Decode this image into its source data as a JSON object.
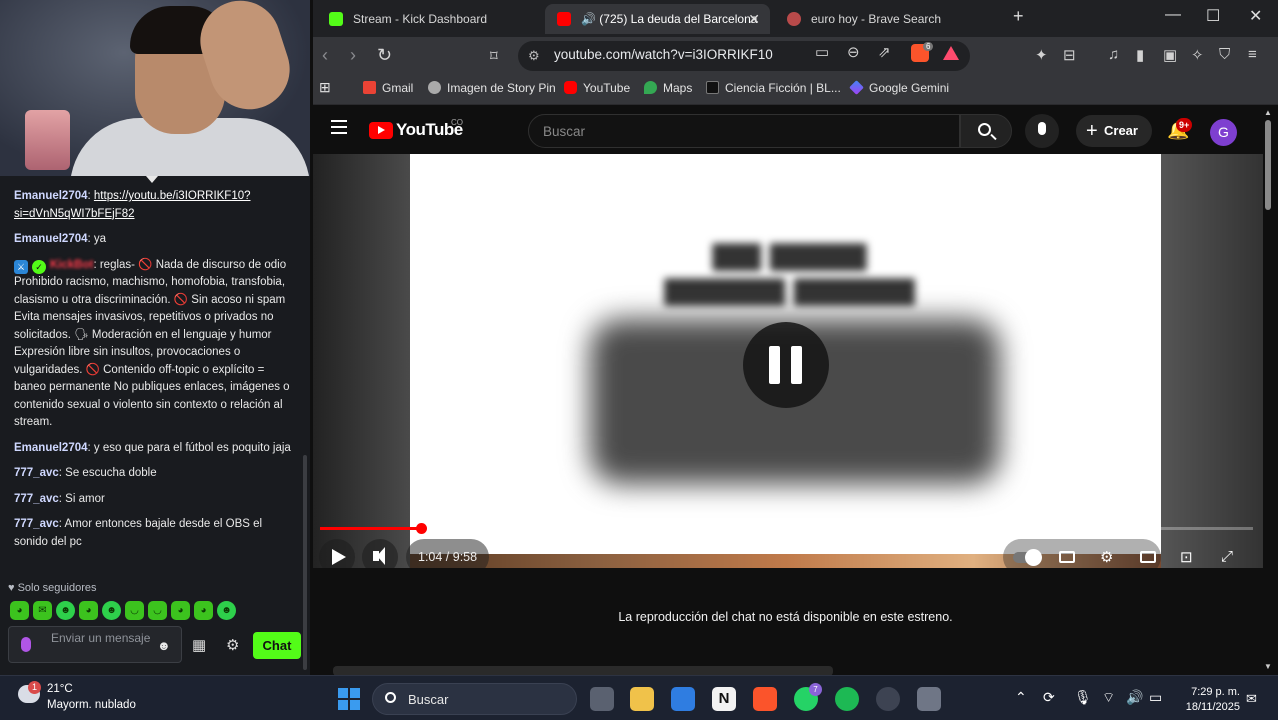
{
  "chat": {
    "messages": [
      {
        "user": "Emanuel2704",
        "sep": ": ",
        "link": "https://youtu.be/i3IORRIKF10?si=dVnN5qWI7bFEjF82"
      },
      {
        "user": "Emanuel2704",
        "sep": ": ",
        "text": "ya"
      },
      {
        "user": "KickBot",
        "sep": ": ",
        "text": "reglas- 🚫 Nada de discurso de odio Prohibido racismo, machismo, homofobia, transfobia, clasismo u otra discriminación. 🚫 Sin acoso ni spam Evita mensajes invasivos, repetitivos o privados no solicitados. 🗣 Moderación en el lenguaje y humor Expresión libre sin insultos, provocaciones o vulgaridades. 🚫 Contenido off-topic o explícito = baneo permanente No publiques enlaces, imágenes o contenido sexual o violento sin contexto o relación al stream."
      },
      {
        "user": "Emanuel2704",
        "sep": ": ",
        "text": "y eso que para el fútbol es poquito jaja"
      },
      {
        "user": "777_avc",
        "sep": ": ",
        "text": "Se escucha doble"
      },
      {
        "user": "777_avc",
        "sep": ": ",
        "text": "Si amor"
      },
      {
        "user": "777_avc",
        "sep": ": ",
        "text": "Amor entonces bajale desde el OBS el sonido del pc"
      }
    ],
    "followers_only": "Solo seguidores",
    "input_placeholder": "Enviar un mensaje",
    "send_label": "Chat",
    "accent": "#53fc18"
  },
  "browser": {
    "tabs": [
      {
        "title": "Stream - Kick Dashboard",
        "icon": "kick-icon"
      },
      {
        "title": "(725) La deuda del Barcelona",
        "icon": "youtube-icon",
        "audio": "🔊"
      },
      {
        "title": "euro hoy - Brave Search",
        "icon": "brave-search-icon"
      }
    ],
    "url": "youtube.com/watch?v=i3IORRIKF10",
    "brave_shield_count": "6",
    "bookmarks": [
      "Gmail",
      "Imagen de Story Pin",
      "YouTube",
      "Maps",
      "Ciencia Ficción | BL...",
      "Google Gemini"
    ]
  },
  "youtube": {
    "logo_text": "YouTube",
    "country": "CO",
    "search_placeholder": "Buscar",
    "create_label": "Crear",
    "notif_count": "9+",
    "avatar_letter": "G",
    "time_display": "1:04 / 9:58",
    "progress_fraction": 0.108,
    "loaded_fraction": 0.31,
    "chat_unavailable": "La reproducción del chat no está disponible en este estreno.",
    "brand_color": "#ff0000"
  },
  "taskbar": {
    "weather_temp": "21°C",
    "weather_desc": "Mayorm. nublado",
    "weather_badge": "1",
    "search_label": "Buscar",
    "whatsapp_badge": "7",
    "time": "7:29 p. m.",
    "date": "18/11/2025"
  }
}
